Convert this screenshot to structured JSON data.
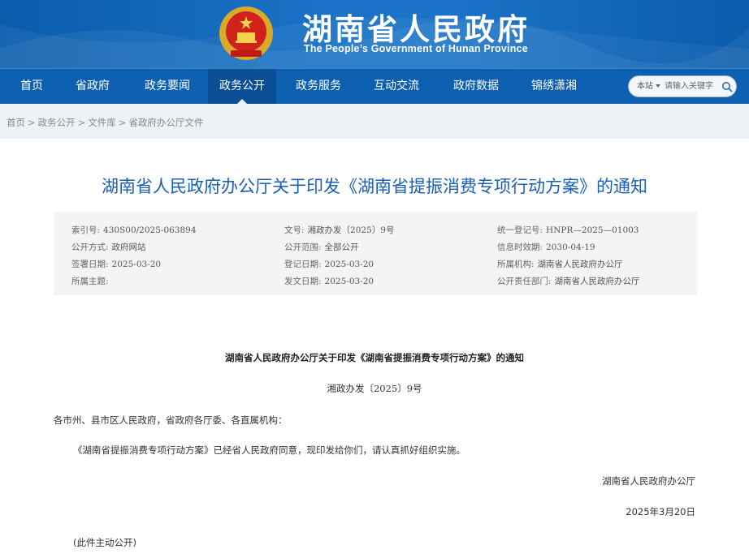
{
  "header": {
    "title_cn": "湖南省人民政府",
    "title_en": "The People’s Government of Hunan Province",
    "emblem_icon": "national-emblem-icon",
    "colors": {
      "banner": "#1a73c7",
      "nav": "#0d5fb0",
      "title_link": "#1a5fb4"
    }
  },
  "nav": {
    "items": [
      {
        "label": "首页"
      },
      {
        "label": "省政府"
      },
      {
        "label": "政务要闻"
      },
      {
        "label": "政务公开"
      },
      {
        "label": "政务服务"
      },
      {
        "label": "互动交流"
      },
      {
        "label": "政府数据"
      },
      {
        "label": "锦绣潇湘"
      }
    ],
    "active": "政务公开",
    "search": {
      "scope": "本站",
      "placeholder": "请输入关键字",
      "icon": "search-icon"
    }
  },
  "breadcrumb": [
    "首页",
    "政务公开",
    "文件库",
    "省政府办公厅文件"
  ],
  "document": {
    "title": "湖南省人民政府办公厅关于印发《湖南省提振消费专项行动方案》的通知",
    "meta": [
      {
        "key": "索引号:",
        "value": "430S00/2025-063894"
      },
      {
        "key": "文号:",
        "value": "湘政办发〔2025〕9号"
      },
      {
        "key": "统一登记号:",
        "value": "HNPR—2025—01003"
      },
      {
        "key": "公开方式:",
        "value": "政府网站"
      },
      {
        "key": "公开范围:",
        "value": "全部公开"
      },
      {
        "key": "信息时效期:",
        "value": "2030-04-19"
      },
      {
        "key": "签署日期:",
        "value": "2025-03-20"
      },
      {
        "key": "登记日期:",
        "value": "2025-03-20"
      },
      {
        "key": "所属机构:",
        "value": "湖南省人民政府办公厅"
      },
      {
        "key": "所属主题:",
        "value": ""
      },
      {
        "key": "发文日期:",
        "value": "2025-03-20"
      },
      {
        "key": "公开责任部门:",
        "value": "湖南省人民政府办公厅"
      }
    ],
    "body_title": "湖南省人民政府办公厅关于印发《湖南省提振消费专项行动方案》的通知",
    "doc_number": "湘政办发〔2025〕9号",
    "addressee": "各市州、县市区人民政府，省政府各厅委、各直属机构：",
    "paragraph": "《湖南省提振消费专项行动方案》已经省人民政府同意，现印发给你们，请认真抓好组织实施。",
    "signer": "湖南省人民政府办公厅",
    "date": "2025年3月20日",
    "public_note": "(此件主动公开)"
  }
}
